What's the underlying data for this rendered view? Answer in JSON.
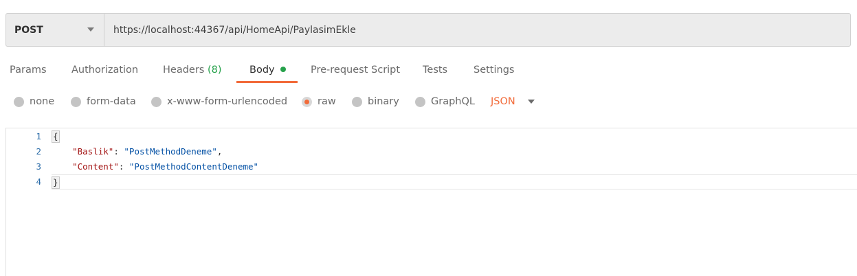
{
  "request": {
    "method": "POST",
    "url": "https://localhost:44367/api/HomeApi/PaylasimEkle"
  },
  "tabs": [
    {
      "label": "Params"
    },
    {
      "label": "Authorization"
    },
    {
      "label": "Headers",
      "count": "(8)"
    },
    {
      "label": "Body",
      "active": true
    },
    {
      "label": "Pre-request Script"
    },
    {
      "label": "Tests"
    },
    {
      "label": "Settings"
    }
  ],
  "body_types": [
    {
      "label": "none",
      "selected": false
    },
    {
      "label": "form-data",
      "selected": false
    },
    {
      "label": "x-www-form-urlencoded",
      "selected": false
    },
    {
      "label": "raw",
      "selected": true
    },
    {
      "label": "binary",
      "selected": false
    },
    {
      "label": "GraphQL",
      "selected": false
    }
  ],
  "raw_format": "JSON",
  "editor": {
    "line_numbers": [
      "1",
      "2",
      "3",
      "4"
    ],
    "open_brace": "{",
    "close_brace": "}",
    "fields": [
      {
        "key": "\"Baslik\"",
        "value": "\"PostMethodDeneme\"",
        "trail": ","
      },
      {
        "key": "\"Content\"",
        "value": "\"PostMethodContentDeneme\"",
        "trail": ""
      }
    ],
    "colon": ": "
  },
  "colors": {
    "accent": "#f26b3a",
    "status_dot": "#26a14b",
    "json_key": "#a31515",
    "json_string": "#0451a5"
  }
}
